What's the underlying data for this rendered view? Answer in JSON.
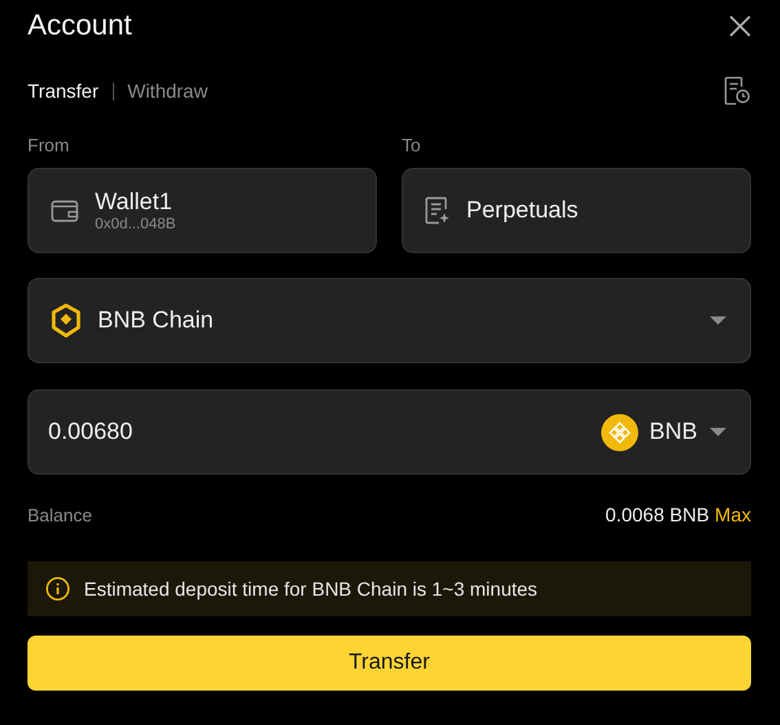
{
  "window": {
    "title": "Account"
  },
  "tabs": [
    {
      "label": "Transfer",
      "selected": true
    },
    {
      "label": "Withdraw",
      "selected": false
    }
  ],
  "from": {
    "label": "From",
    "name": "Wallet1",
    "address": "0x0d...048B"
  },
  "to": {
    "label": "To",
    "name": "Perpetuals"
  },
  "network": {
    "value": "BNB Chain"
  },
  "amount": {
    "value": "0.00680",
    "token": "BNB"
  },
  "balance": {
    "label": "Balance",
    "value": "0.0068 BNB",
    "max": "Max"
  },
  "notice": "Estimated deposit time for BNB Chain is 1~3 minutes",
  "submit": "Transfer"
}
